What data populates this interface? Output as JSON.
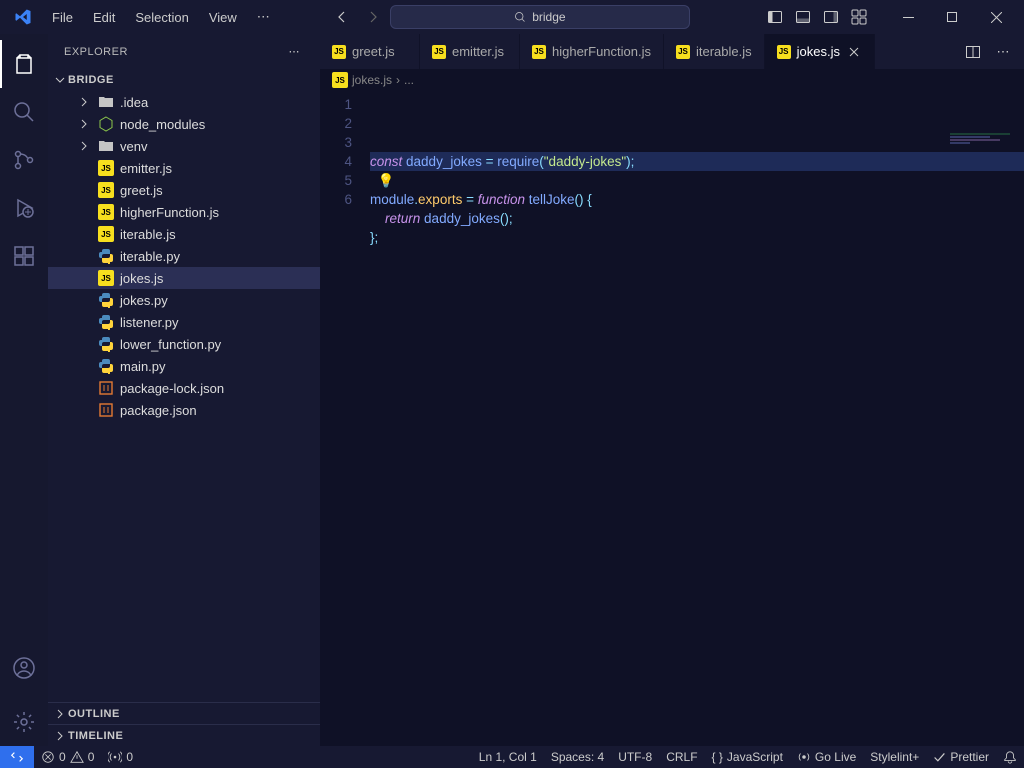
{
  "menu": {
    "items": [
      "File",
      "Edit",
      "Selection",
      "View"
    ]
  },
  "search": {
    "text": "bridge"
  },
  "activity": {
    "icons": [
      "files",
      "search",
      "git",
      "debug",
      "extensions"
    ],
    "active": 0
  },
  "sidebar": {
    "title": "EXPLORER",
    "project": "BRIDGE",
    "outline": "OUTLINE",
    "timeline": "TIMELINE",
    "tree": [
      {
        "type": "folder",
        "name": ".idea",
        "depth": 1,
        "icon": "folder"
      },
      {
        "type": "folder",
        "name": "node_modules",
        "depth": 1,
        "icon": "node"
      },
      {
        "type": "folder",
        "name": "venv",
        "depth": 1,
        "icon": "folder"
      },
      {
        "type": "file",
        "name": "emitter.js",
        "depth": 1,
        "icon": "js"
      },
      {
        "type": "file",
        "name": "greet.js",
        "depth": 1,
        "icon": "js"
      },
      {
        "type": "file",
        "name": "higherFunction.js",
        "depth": 1,
        "icon": "js"
      },
      {
        "type": "file",
        "name": "iterable.js",
        "depth": 1,
        "icon": "js"
      },
      {
        "type": "file",
        "name": "iterable.py",
        "depth": 1,
        "icon": "py"
      },
      {
        "type": "file",
        "name": "jokes.js",
        "depth": 1,
        "icon": "js",
        "selected": true
      },
      {
        "type": "file",
        "name": "jokes.py",
        "depth": 1,
        "icon": "py"
      },
      {
        "type": "file",
        "name": "listener.py",
        "depth": 1,
        "icon": "py"
      },
      {
        "type": "file",
        "name": "lower_function.py",
        "depth": 1,
        "icon": "py"
      },
      {
        "type": "file",
        "name": "main.py",
        "depth": 1,
        "icon": "py"
      },
      {
        "type": "file",
        "name": "package-lock.json",
        "depth": 1,
        "icon": "json"
      },
      {
        "type": "file",
        "name": "package.json",
        "depth": 1,
        "icon": "json"
      }
    ]
  },
  "tabs": [
    {
      "name": "greet.js",
      "icon": "js"
    },
    {
      "name": "emitter.js",
      "icon": "js"
    },
    {
      "name": "higherFunction.js",
      "icon": "js"
    },
    {
      "name": "iterable.js",
      "icon": "js"
    },
    {
      "name": "jokes.js",
      "icon": "js",
      "active": true
    }
  ],
  "breadcrumb": {
    "file": "jokes.js",
    "sep": "›",
    "rest": "..."
  },
  "code": {
    "lines": 6,
    "tokens": [
      [
        [
          "const ",
          "k-const"
        ],
        [
          "daddy_jokes",
          "k-var"
        ],
        [
          " = ",
          "k-op"
        ],
        [
          "require",
          "k-fn"
        ],
        [
          "(",
          "k-pun"
        ],
        [
          "\"daddy-jokes\"",
          "k-str"
        ],
        [
          ")",
          "k-pun"
        ],
        [
          ";",
          "k-pun"
        ]
      ],
      [
        [
          "  💡",
          "bulb"
        ]
      ],
      [
        [
          "module",
          "k-var"
        ],
        [
          ".",
          "k-pun"
        ],
        [
          "exports",
          "k-id"
        ],
        [
          " = ",
          "k-op"
        ],
        [
          "function ",
          "k-kw"
        ],
        [
          "tellJoke",
          "k-fn"
        ],
        [
          "()",
          "k-pun"
        ],
        [
          " {",
          "k-pun"
        ]
      ],
      [
        [
          "    ",
          ""
        ],
        [
          "return ",
          "k-kw"
        ],
        [
          "daddy_jokes",
          "k-fn"
        ],
        [
          "()",
          "k-pun"
        ],
        [
          ";",
          "k-pun"
        ]
      ],
      [
        [
          "};",
          "k-pun"
        ]
      ],
      [
        [
          "",
          ""
        ]
      ]
    ],
    "highlight": 0
  },
  "status": {
    "errors": "0",
    "warnings": "0",
    "ports": "0",
    "ln_col": "Ln 1, Col 1",
    "spaces": "Spaces: 4",
    "encoding": "UTF-8",
    "eol": "CRLF",
    "lang": "JavaScript",
    "golive": "Go Live",
    "stylelint": "Stylelint+",
    "prettier": "Prettier"
  }
}
